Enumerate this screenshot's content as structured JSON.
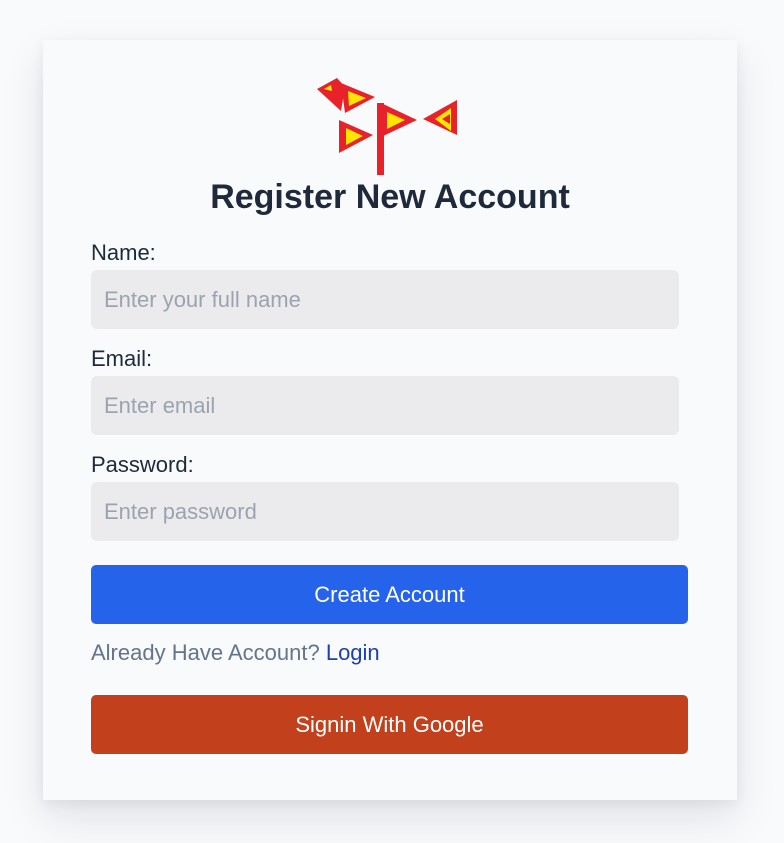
{
  "form": {
    "title": "Register New Account",
    "name_label": "Name:",
    "name_placeholder": "Enter your full name",
    "email_label": "Email:",
    "email_placeholder": "Enter email",
    "password_label": "Password:",
    "password_placeholder": "Enter password",
    "create_button": "Create Account",
    "login_prompt": "Already Have Account?",
    "login_link": "Login",
    "google_button": "Signin With Google"
  },
  "logo": {
    "icon": "bird-flags-logo",
    "colors": {
      "flag": "#e8222a",
      "fill": "#ffe500"
    }
  },
  "colors": {
    "primary": "#2563eb",
    "google": "#c2411c",
    "link": "#1e40af",
    "heading": "#1e293b"
  }
}
